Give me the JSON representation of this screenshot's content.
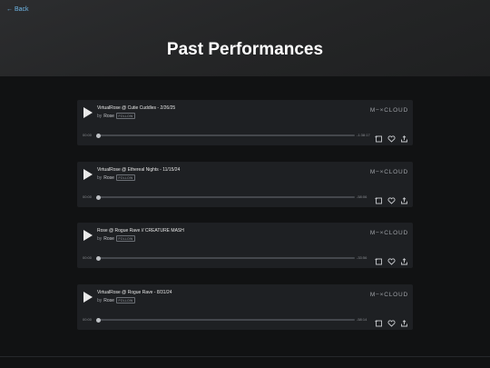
{
  "nav": {
    "back_label": "← Back"
  },
  "page": {
    "title": "Past Performances"
  },
  "brand": "M−×CLOUD",
  "players": [
    {
      "title": "VirtualRose @ Cutie Cuddles - 2/26/25",
      "by": "by",
      "artist": "Rose",
      "follow": "FOLLOW",
      "time_elapsed": "00:00",
      "time_remaining": "-1:38:17",
      "progress": 0
    },
    {
      "title": "VirtualRose @ Ethereal Nights - 11/15/24",
      "by": "by",
      "artist": "Rose",
      "follow": "FOLLOW",
      "time_elapsed": "00:00",
      "time_remaining": "-58:06",
      "progress": 0
    },
    {
      "title": "Rose @ Rogue Rave // CREATURE MASH",
      "by": "by",
      "artist": "Rose",
      "follow": "FOLLOW",
      "time_elapsed": "00:00",
      "time_remaining": "-33:56",
      "progress": 0
    },
    {
      "title": "VirtualRose @ Rogue Rave - 8/31/24",
      "by": "by",
      "artist": "Rose",
      "follow": "FOLLOW",
      "time_elapsed": "00:00",
      "time_remaining": "-58:14",
      "progress": 0
    }
  ],
  "icons": {
    "play": "play-icon",
    "repost": "repost-icon",
    "like": "heart-icon",
    "share": "share-icon"
  },
  "colors": {
    "background": "#111213",
    "header": "#262729",
    "player": "#1e2023",
    "link": "#6fb6e6",
    "title": "#ffffff"
  }
}
